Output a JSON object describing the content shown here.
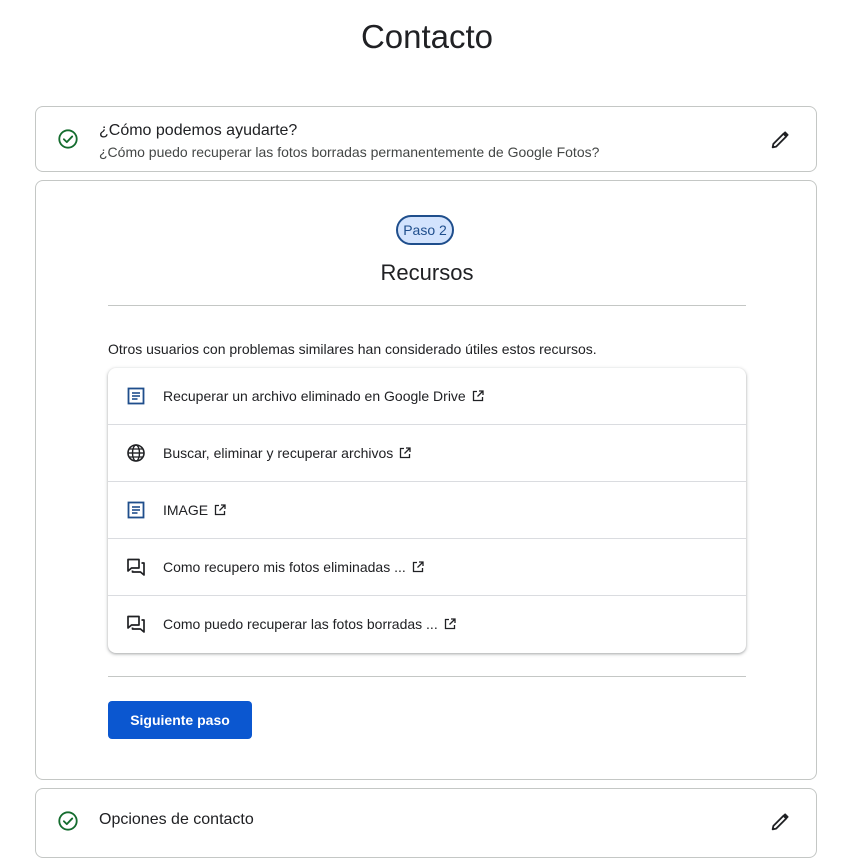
{
  "page": {
    "title": "Contacto"
  },
  "step1": {
    "heading": "¿Cómo podemos ayudarte?",
    "subtitle": "¿Cómo puedo recuperar las fotos borradas permanentemente de Google Fotos?",
    "status_icon": "check-circle-icon",
    "edit_icon": "pencil-icon"
  },
  "step2": {
    "badge": "Paso 2",
    "title": "Recursos",
    "intro": "Otros usuarios con problemas similares han considerado útiles estos recursos.",
    "resources": [
      {
        "label": "Recuperar un archivo eliminado en Google Drive",
        "icon": "article-icon"
      },
      {
        "label": "Buscar, eliminar y recuperar archivos",
        "icon": "globe-icon"
      },
      {
        "label": "IMAGE",
        "icon": "article-icon"
      },
      {
        "label": "Como recupero mis fotos eliminadas ...",
        "icon": "forum-icon"
      },
      {
        "label": "Como puedo recuperar las fotos borradas ...",
        "icon": "forum-icon"
      }
    ],
    "next_button": "Siguiente paso"
  },
  "step3": {
    "heading": "Opciones de contacto",
    "status_icon": "check-circle-icon",
    "edit_icon": "pencil-icon"
  },
  "colors": {
    "primary": "#0b57d0",
    "success": "#146c2e",
    "badge_bg": "#d3e3fd",
    "badge_border": "#1f4e8c",
    "doc_icon": "#1f4e8c"
  }
}
